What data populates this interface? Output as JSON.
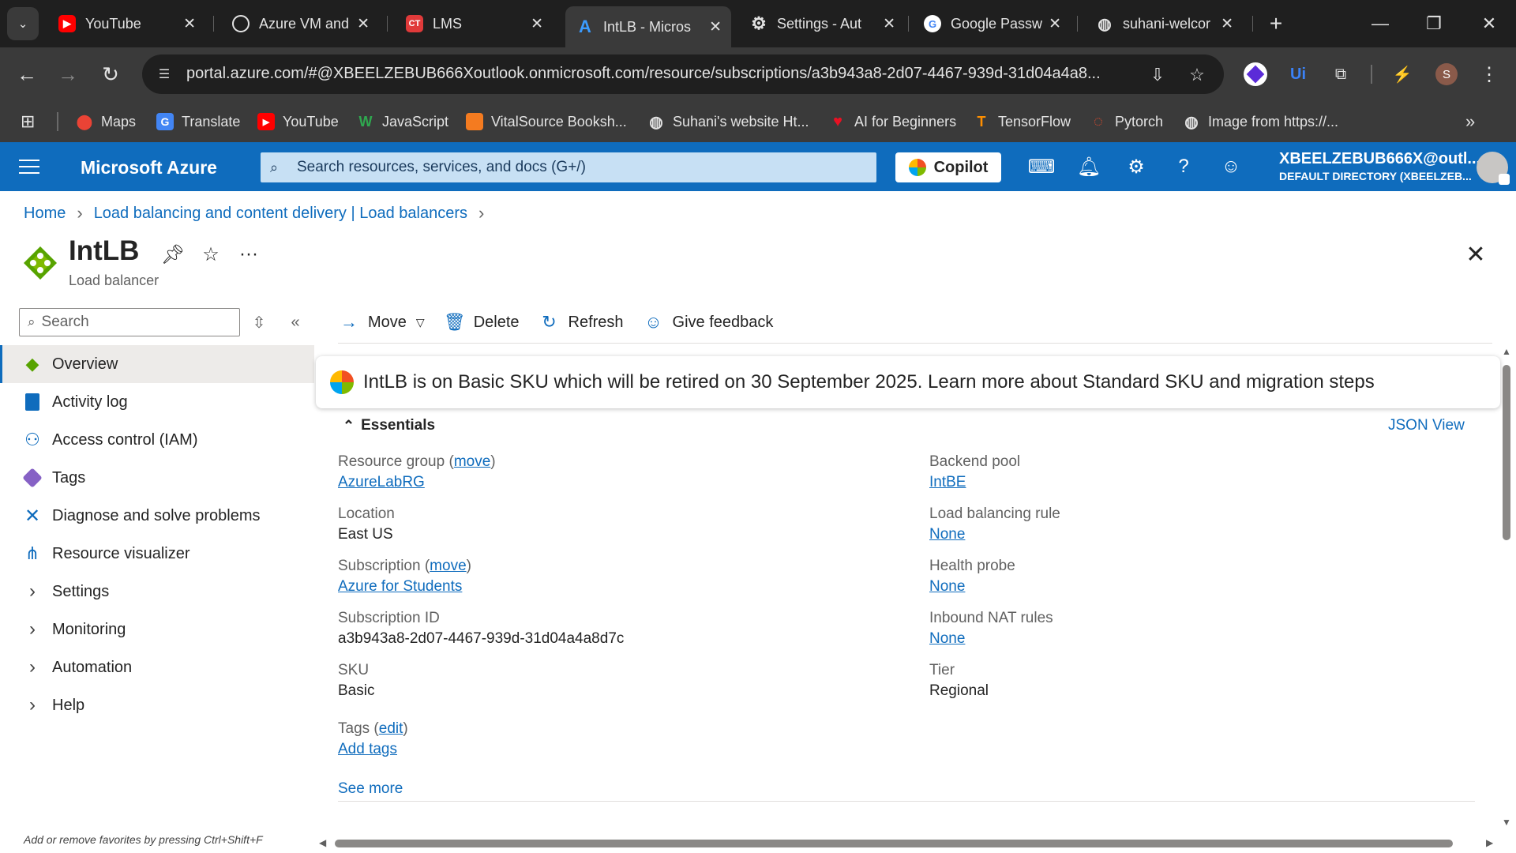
{
  "browser": {
    "tabs": [
      {
        "title": "YouTube",
        "icon": "youtube-icon",
        "color": "#ff0000"
      },
      {
        "title": "Azure VM and",
        "icon": "openai-icon",
        "color": "#3a3a3a"
      },
      {
        "title": "LMS",
        "icon": "lms-icon",
        "color": "#e03a3a"
      },
      {
        "title": "IntLB - Micros",
        "icon": "azure-icon",
        "color": "#3a3a3a"
      },
      {
        "title": "Settings - Aut",
        "icon": "gear-icon",
        "color": "#1f1f1f"
      },
      {
        "title": "Google Passw",
        "icon": "google-icon",
        "color": "#ffffff"
      },
      {
        "title": "suhani-welcor",
        "icon": "globe-icon",
        "color": "#1f1f1f"
      }
    ],
    "url": "portal.azure.com/#@XBEELZEBUB666Xoutlook.onmicrosoft.com/resource/subscriptions/a3b943a8-2d07-4467-939d-31d04a4a8...",
    "profile_initial": "S",
    "bookmarks": [
      {
        "label": "Maps",
        "icon": "maps-icon"
      },
      {
        "label": "Translate",
        "icon": "translate-icon"
      },
      {
        "label": "YouTube",
        "icon": "youtube-icon"
      },
      {
        "label": "JavaScript",
        "icon": "javascript-icon"
      },
      {
        "label": "VitalSource Booksh...",
        "icon": "vitalsource-icon"
      },
      {
        "label": "Suhani's website Ht...",
        "icon": "globe-icon"
      },
      {
        "label": "AI for Beginners",
        "icon": "heart-icon"
      },
      {
        "label": "TensorFlow",
        "icon": "tensorflow-icon"
      },
      {
        "label": "Pytorch",
        "icon": "pytorch-icon"
      },
      {
        "label": "Image from https://...",
        "icon": "globe-icon"
      }
    ]
  },
  "azure": {
    "brand": "Microsoft Azure",
    "search_placeholder": "Search resources, services, and docs (G+/)",
    "copilot": "Copilot",
    "user_email": "XBEELZEBUB666X@outl...",
    "user_directory": "DEFAULT DIRECTORY (XBEELZEB...",
    "accent": "#0f6cbd"
  },
  "breadcrumb": [
    "Home",
    "Load balancing and content delivery | Load balancers"
  ],
  "resource": {
    "title": "IntLB",
    "subtitle": "Load balancer"
  },
  "nav": {
    "search_placeholder": "Search",
    "items": [
      {
        "label": "Overview",
        "icon": "overview-icon",
        "selected": true
      },
      {
        "label": "Activity log",
        "icon": "activity-log-icon"
      },
      {
        "label": "Access control (IAM)",
        "icon": "iam-icon"
      },
      {
        "label": "Tags",
        "icon": "tag-icon"
      },
      {
        "label": "Diagnose and solve problems",
        "icon": "diagnose-icon"
      },
      {
        "label": "Resource visualizer",
        "icon": "visualizer-icon"
      },
      {
        "label": "Settings",
        "icon": "chevron-right-icon"
      },
      {
        "label": "Monitoring",
        "icon": "chevron-right-icon"
      },
      {
        "label": "Automation",
        "icon": "chevron-right-icon"
      },
      {
        "label": "Help",
        "icon": "chevron-right-icon"
      }
    ],
    "footer": "Add or remove favorites by pressing Ctrl+Shift+F"
  },
  "commands": {
    "move": "Move",
    "delete": "Delete",
    "refresh": "Refresh",
    "feedback": "Give feedback"
  },
  "banner": "IntLB is on Basic SKU which will be retired on 30 September 2025. Learn more about Standard SKU and migration steps",
  "essentials": {
    "title": "Essentials",
    "json_view": "JSON View",
    "resource_group_label": "Resource group",
    "resource_group_action": "move",
    "resource_group_value": "AzureLabRG",
    "location_label": "Location",
    "location_value": "East US",
    "subscription_label": "Subscription",
    "subscription_action": "move",
    "subscription_value": "Azure for Students",
    "subscription_id_label": "Subscription ID",
    "subscription_id_value": "a3b943a8-2d07-4467-939d-31d04a4a8d7c",
    "sku_label": "SKU",
    "sku_value": "Basic",
    "tags_label": "Tags",
    "tags_action": "edit",
    "tags_value": "Add tags",
    "backend_pool_label": "Backend pool",
    "backend_pool_value": "IntBE",
    "lb_rule_label": "Load balancing rule",
    "lb_rule_value": "None",
    "health_probe_label": "Health probe",
    "health_probe_value": "None",
    "nat_label": "Inbound NAT rules",
    "nat_value": "None",
    "tier_label": "Tier",
    "tier_value": "Regional",
    "see_more": "See more"
  }
}
